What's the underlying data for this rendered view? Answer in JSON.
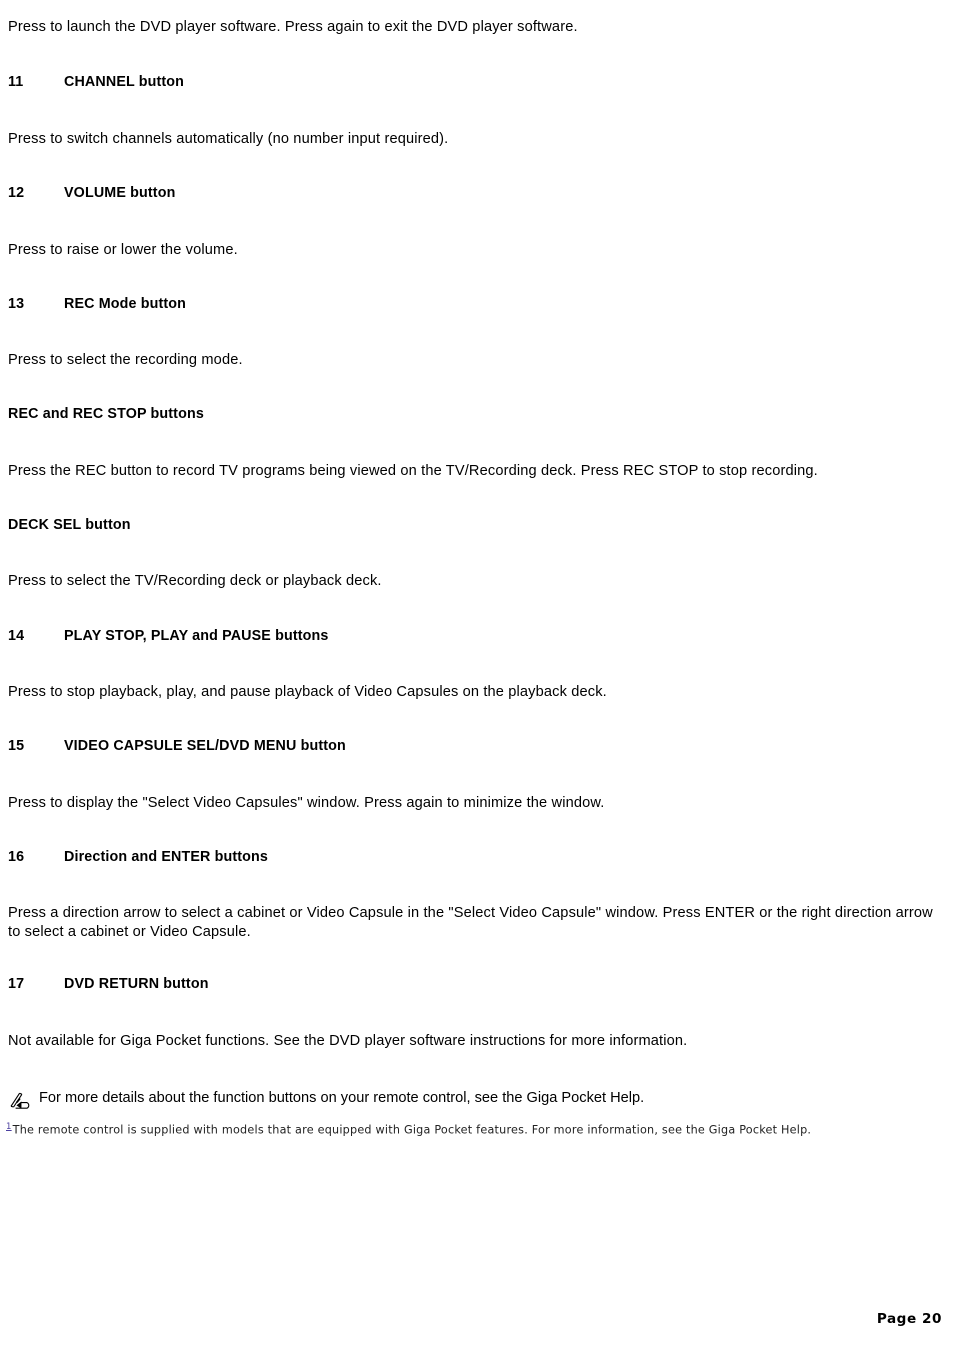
{
  "document": {
    "page_label": "Page 20",
    "intro_paragraph": "Press to launch the DVD player software. Press again to exit the DVD player software.",
    "sections": [
      {
        "number": "11",
        "title": "CHANNEL button",
        "body": "Press to switch channels automatically (no number input required)."
      },
      {
        "number": "12",
        "title": "VOLUME button",
        "body": "Press to raise or lower the volume."
      },
      {
        "number": "13",
        "title": "REC Mode button",
        "body": "Press to select the recording mode."
      },
      {
        "number": "",
        "title": "REC and REC STOP buttons",
        "body": "Press the REC button to record TV programs being viewed on the TV/Recording deck. Press REC STOP to stop recording."
      },
      {
        "number": "",
        "title": "DECK SEL button",
        "body": "Press to select the TV/Recording deck or playback deck."
      },
      {
        "number": "14",
        "title": "PLAY STOP, PLAY and PAUSE buttons",
        "body": "Press to stop playback, play, and pause playback of Video Capsules on the playback deck."
      },
      {
        "number": "15",
        "title": "VIDEO CAPSULE SEL/DVD MENU button",
        "body": "Press to display the \"Select Video Capsules\" window. Press again to minimize the window."
      },
      {
        "number": "16",
        "title": "Direction and ENTER buttons",
        "body": "Press a direction arrow to select a cabinet or Video Capsule in the \"Select Video Capsule\" window. Press ENTER or the right direction arrow to select a cabinet or Video Capsule."
      },
      {
        "number": "17",
        "title": "DVD RETURN button",
        "body": "Not available for Giga Pocket functions. See the DVD player software instructions for more information."
      }
    ],
    "note": {
      "icon": "note-pencil-icon",
      "text": "For more details about the function buttons on your remote control, see the Giga Pocket Help."
    },
    "footnote": {
      "marker": "1",
      "text": "The remote control is supplied with models that are equipped with Giga Pocket features. For more information, see the Giga Pocket Help."
    }
  }
}
